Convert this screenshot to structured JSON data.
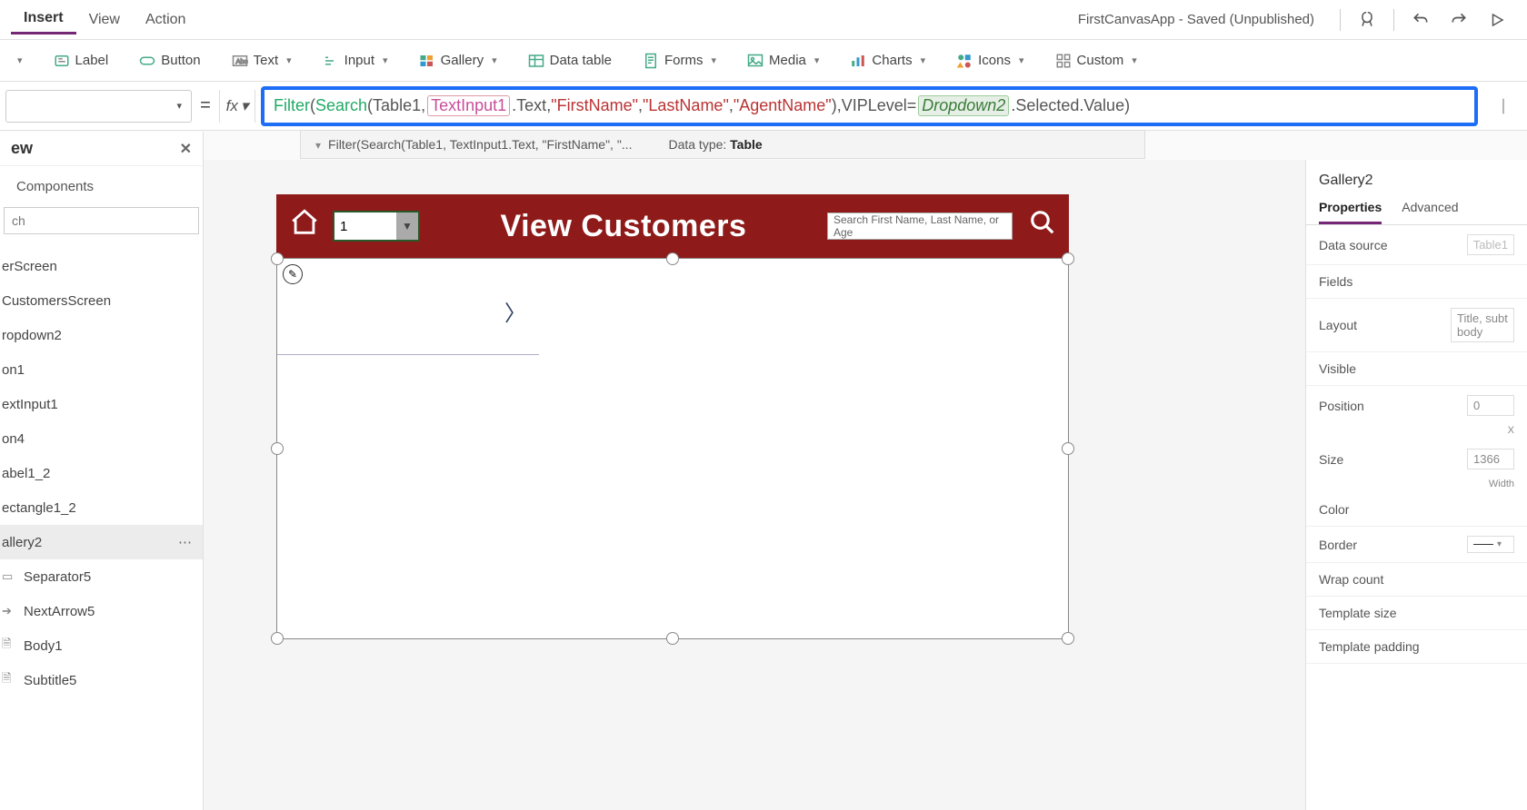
{
  "menubar": {
    "tabs": [
      "Insert",
      "View",
      "Action"
    ],
    "active_index": 0,
    "app_state": "FirstCanvasApp - Saved (Unpublished)"
  },
  "ribbon": {
    "items": [
      "",
      "Label",
      "Button",
      "Text",
      "Input",
      "Gallery",
      "Data table",
      "Forms",
      "Media",
      "Charts",
      "Icons",
      "Custom"
    ]
  },
  "formula": {
    "equals": "=",
    "fx": "fx",
    "tokens": {
      "filter": "Filter",
      "search": "Search",
      "table": "Table1",
      "textinput": "TextInput1",
      "text_suffix": ".Text",
      "str1": "\"FirstName\"",
      "str2": "\"LastName\"",
      "str3": "\"AgentName\"",
      "viplevel": "VIPLevel",
      "dropdown": "Dropdown2",
      "sel_suffix": ".Selected.Value"
    },
    "breadcrumb": "Filter(Search(Table1, TextInput1.Text, \"FirstName\", \"...",
    "datatype_label": "Data type: ",
    "datatype_value": "Table"
  },
  "leftpanel": {
    "title": "ew",
    "tab": "Components",
    "search_placeholder": "ch",
    "items": [
      {
        "label": "erScreen"
      },
      {
        "label": "CustomersScreen"
      },
      {
        "label": "ropdown2"
      },
      {
        "label": "on1"
      },
      {
        "label": "extInput1"
      },
      {
        "label": "on4"
      },
      {
        "label": "abel1_2"
      },
      {
        "label": "ectangle1_2"
      },
      {
        "label": "allery2",
        "selected": true
      },
      {
        "label": "Separator5",
        "icon": true
      },
      {
        "label": "NextArrow5",
        "icon": true
      },
      {
        "label": "Body1",
        "icon": true
      },
      {
        "label": "Subtitle5",
        "icon": true
      }
    ]
  },
  "rightpanel": {
    "title": "Gallery2",
    "tabs": [
      "Properties",
      "Advanced"
    ],
    "active_tab": 0,
    "props": {
      "data_source_label": "Data source",
      "data_source_value": "Table1",
      "fields_label": "Fields",
      "layout_label": "Layout",
      "layout_value": "Title, subt body",
      "visible_label": "Visible",
      "position_label": "Position",
      "position_x": "0",
      "position_x_label": "X",
      "size_label": "Size",
      "size_w": "1366",
      "size_w_label": "Width",
      "color_label": "Color",
      "border_label": "Border",
      "wrap_label": "Wrap count",
      "tmpl_size_label": "Template size",
      "tmpl_pad_label": "Template padding"
    }
  },
  "canvas_app": {
    "header_title": "View Customers",
    "dropdown_value": "1",
    "search_placeholder": "Search First Name, Last Name, or Age"
  }
}
